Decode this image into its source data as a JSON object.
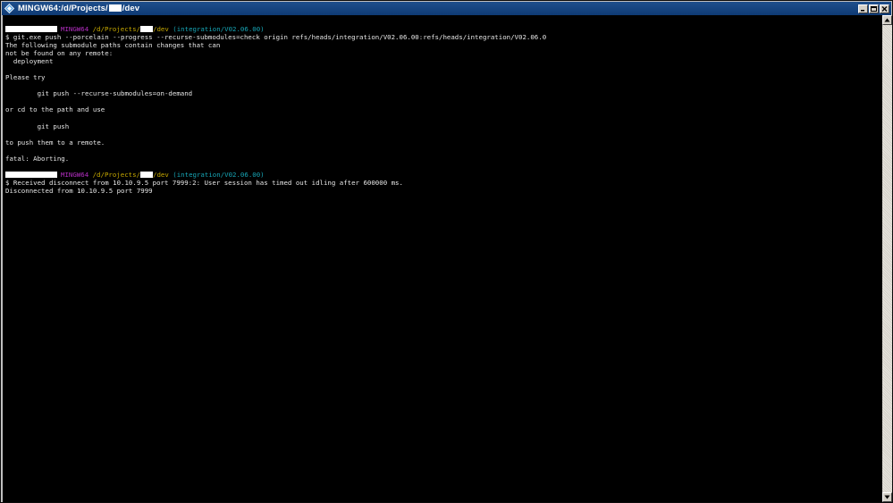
{
  "window": {
    "title_prefix": "MINGW64:/d/Projects/",
    "title_suffix": "/dev"
  },
  "prompt1": {
    "host": "MINGW64",
    "path_prefix": "/d/Projects/",
    "path_suffix": "/dev",
    "branch": "(integration/V02.06.00)"
  },
  "output1": [
    "$ git.exe push --porcelain --progress --recurse-submodules=check origin refs/heads/integration/V02.06.00:refs/heads/integration/V02.06.0",
    "The following submodule paths contain changes that can",
    "not be found on any remote:",
    "  deployment",
    "",
    "Please try",
    "",
    "        git push --recurse-submodules=on-demand",
    "",
    "or cd to the path and use",
    "",
    "        git push",
    "",
    "to push them to a remote.",
    "",
    "fatal: Aborting.",
    ""
  ],
  "prompt2": {
    "host": "MINGW64",
    "path_prefix": "/d/Projects/",
    "path_suffix": "/dev",
    "branch": "(integration/V02.06.00)"
  },
  "output2": [
    "$ Received disconnect from 10.10.9.5 port 7999:2: User session has timed out idling after 600000 ms.",
    "Disconnected from 10.10.9.5 port 7999"
  ],
  "colors": {
    "host": "#b62fc4",
    "path": "#c7a900",
    "branch": "#17a6b6",
    "text": "#e6e6e6",
    "background": "#000000"
  },
  "icons": {
    "app": "git-bash-diamond-icon",
    "minimize": "minimize-icon",
    "maximize": "maximize-icon",
    "close": "close-icon"
  }
}
